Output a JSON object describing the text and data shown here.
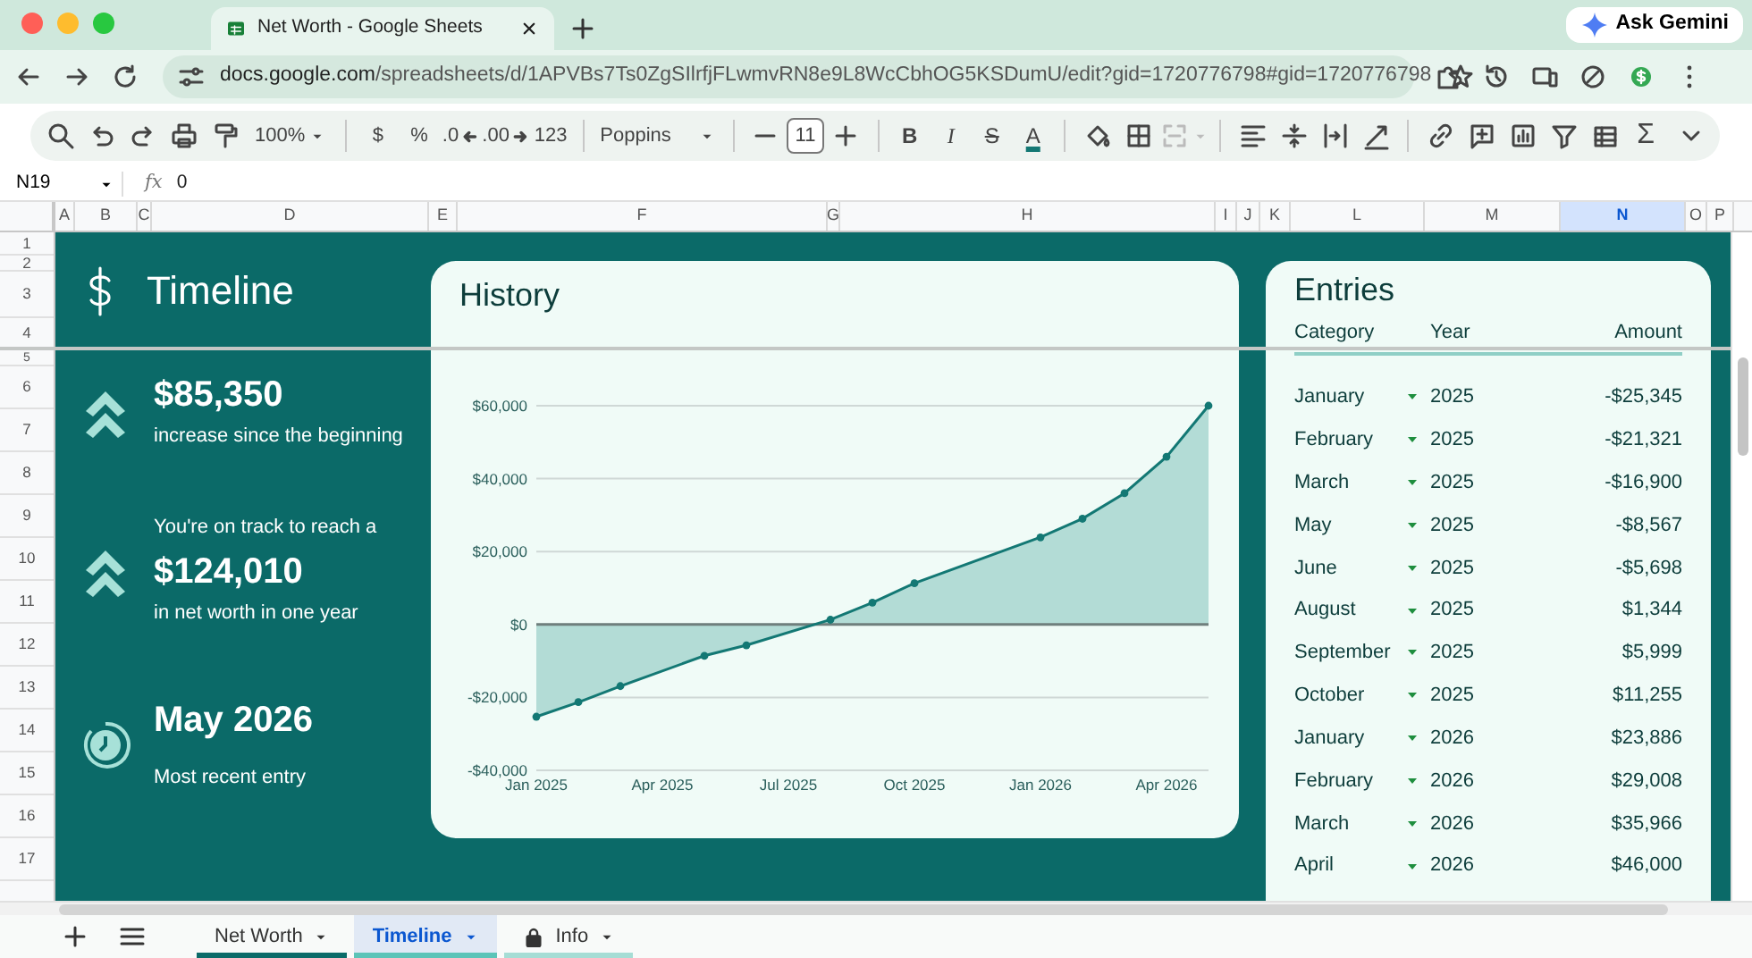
{
  "browser": {
    "tab_title": "Net Worth - Google Sheets",
    "ask_button": "Ask Gemini",
    "url": {
      "host": "docs.google.com",
      "path": "/spreadsheets/d/1APVBs7Ts0ZgSIlrfjFLwmvRN8e9L8WcCbhOG5KSDumU/edit?gid=1720776798#gid=1720776798"
    }
  },
  "toolbar": {
    "zoom": "100%",
    "currency": "$",
    "percent": "%",
    "decimal_decrease": ".0",
    "decimal_increase": ".00",
    "number_format": "123",
    "font": "Poppins",
    "font_size": "11",
    "bold": "B",
    "italic": "I",
    "strikethrough": "S",
    "text_color": "A",
    "functions": "Σ"
  },
  "formula_bar": {
    "cell": "N19",
    "fx": "fx",
    "value": "0"
  },
  "columns": [
    {
      "label": "A",
      "selected": false
    },
    {
      "label": "B",
      "selected": false
    },
    {
      "label": "C",
      "selected": false
    },
    {
      "label": "D",
      "selected": false
    },
    {
      "label": "E",
      "selected": false
    },
    {
      "label": "F",
      "selected": false
    },
    {
      "label": "G",
      "selected": false
    },
    {
      "label": "H",
      "selected": false
    },
    {
      "label": "I",
      "selected": false
    },
    {
      "label": "J",
      "selected": false
    },
    {
      "label": "K",
      "selected": false
    },
    {
      "label": "L",
      "selected": false
    },
    {
      "label": "M",
      "selected": false
    },
    {
      "label": "N",
      "selected": true
    },
    {
      "label": "O",
      "selected": false
    },
    {
      "label": "P",
      "selected": false
    }
  ],
  "rows": [
    "1",
    "2",
    "3",
    "4",
    "5",
    "6",
    "7",
    "8",
    "9",
    "10",
    "11",
    "12",
    "13",
    "14",
    "15",
    "16",
    "17"
  ],
  "left_panel": {
    "title": "Timeline",
    "stats": [
      {
        "kind": "increase",
        "value": "$85,350",
        "caption": "increase since the beginning"
      },
      {
        "kind": "increase",
        "lead": "You're on track to reach a",
        "value": "$124,010",
        "caption": "in net worth in one year"
      },
      {
        "kind": "recent",
        "value": "May 2026",
        "caption": "Most recent entry"
      }
    ]
  },
  "history": {
    "title": "History",
    "chart_data": {
      "type": "area",
      "categories": [
        "Jan 2025",
        null,
        null,
        "Apr 2025",
        null,
        null,
        "Jul 2025",
        null,
        null,
        "Oct 2025",
        null,
        null,
        "Jan 2026",
        null,
        null,
        "Apr 2026",
        null
      ],
      "series": [
        {
          "color": "#137874",
          "values": [
            -25300,
            -21300,
            -16900,
            null,
            -8600,
            -5700,
            null,
            1300,
            6000,
            11300,
            null,
            null,
            23900,
            29000,
            36000,
            46000,
            60000
          ]
        }
      ],
      "ylim": [
        -40000,
        60000
      ],
      "grid": true,
      "yticks": [
        {
          "value": -40000,
          "label": "-$40,000"
        },
        {
          "value": -20000,
          "label": "-$20,000"
        },
        {
          "value": 0,
          "label": "$0"
        },
        {
          "value": 20000,
          "label": "$20,000"
        },
        {
          "value": 40000,
          "label": "$40,000"
        },
        {
          "value": 60000,
          "label": "$60,000"
        }
      ]
    }
  },
  "entries": {
    "title": "Entries",
    "columns": [
      "Category",
      "Year",
      "Amount"
    ],
    "rows": [
      {
        "category": "January",
        "year": "2025",
        "amount": "-$25,345"
      },
      {
        "category": "February",
        "year": "2025",
        "amount": "-$21,321"
      },
      {
        "category": "March",
        "year": "2025",
        "amount": "-$16,900"
      },
      {
        "category": "May",
        "year": "2025",
        "amount": "-$8,567"
      },
      {
        "category": "June",
        "year": "2025",
        "amount": "-$5,698"
      },
      {
        "category": "August",
        "year": "2025",
        "amount": "$1,344"
      },
      {
        "category": "September",
        "year": "2025",
        "amount": "$5,999"
      },
      {
        "category": "October",
        "year": "2025",
        "amount": "$11,255"
      },
      {
        "category": "January",
        "year": "2026",
        "amount": "$23,886"
      },
      {
        "category": "February",
        "year": "2026",
        "amount": "$29,008"
      },
      {
        "category": "March",
        "year": "2026",
        "amount": "$35,966"
      },
      {
        "category": "April",
        "year": "2026",
        "amount": "$46,000"
      }
    ]
  },
  "sheet_tabs": [
    {
      "label": "Net Worth",
      "selected": false,
      "locked": false,
      "color": "#0b6b69"
    },
    {
      "label": "Timeline",
      "selected": true,
      "locked": false,
      "color": "#5cc4b8"
    },
    {
      "label": "Info",
      "selected": false,
      "locked": true,
      "color": "#a6ddd5"
    }
  ]
}
